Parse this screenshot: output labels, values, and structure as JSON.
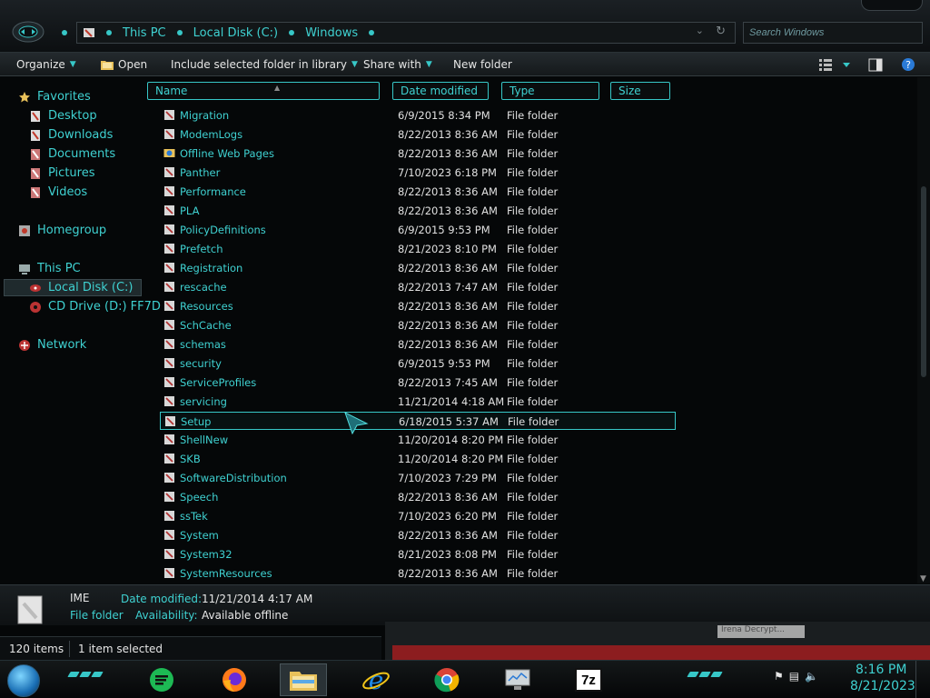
{
  "address_bar": {
    "crumbs": [
      "This PC",
      "Local Disk (C:)",
      "Windows"
    ],
    "search_placeholder": "Search Windows"
  },
  "toolbar": {
    "organize": "Organize",
    "open": "Open",
    "include": "Include selected folder in library",
    "share": "Share with",
    "new_folder": "New folder"
  },
  "nav": {
    "favorites": "Favorites",
    "desktop": "Desktop",
    "downloads": "Downloads",
    "documents": "Documents",
    "pictures": "Pictures",
    "videos": "Videos",
    "homegroup": "Homegroup",
    "this_pc": "This PC",
    "local_disk": "Local Disk (C:)",
    "cd_drive": "CD Drive (D:) FF7D",
    "network": "Network"
  },
  "columns": {
    "name": "Name",
    "date": "Date modified",
    "type": "Type",
    "size": "Size"
  },
  "files": [
    {
      "name": "Migration",
      "date": "6/9/2015 8:34 PM",
      "type": "File folder"
    },
    {
      "name": "ModemLogs",
      "date": "8/22/2013 8:36 AM",
      "type": "File folder"
    },
    {
      "name": "Offline Web Pages",
      "date": "8/22/2013 8:36 AM",
      "type": "File folder"
    },
    {
      "name": "Panther",
      "date": "7/10/2023 6:18 PM",
      "type": "File folder"
    },
    {
      "name": "Performance",
      "date": "8/22/2013 8:36 AM",
      "type": "File folder"
    },
    {
      "name": "PLA",
      "date": "8/22/2013 8:36 AM",
      "type": "File folder"
    },
    {
      "name": "PolicyDefinitions",
      "date": "6/9/2015 9:53 PM",
      "type": "File folder"
    },
    {
      "name": "Prefetch",
      "date": "8/21/2023 8:10 PM",
      "type": "File folder"
    },
    {
      "name": "Registration",
      "date": "8/22/2013 8:36 AM",
      "type": "File folder"
    },
    {
      "name": "rescache",
      "date": "8/22/2013 7:47 AM",
      "type": "File folder"
    },
    {
      "name": "Resources",
      "date": "8/22/2013 8:36 AM",
      "type": "File folder"
    },
    {
      "name": "SchCache",
      "date": "8/22/2013 8:36 AM",
      "type": "File folder"
    },
    {
      "name": "schemas",
      "date": "8/22/2013 8:36 AM",
      "type": "File folder"
    },
    {
      "name": "security",
      "date": "6/9/2015 9:53 PM",
      "type": "File folder"
    },
    {
      "name": "ServiceProfiles",
      "date": "8/22/2013 7:45 AM",
      "type": "File folder"
    },
    {
      "name": "servicing",
      "date": "11/21/2014 4:18 AM",
      "type": "File folder"
    },
    {
      "name": "Setup",
      "date": "6/18/2015 5:37 AM",
      "type": "File folder"
    },
    {
      "name": "ShellNew",
      "date": "11/20/2014 8:20 PM",
      "type": "File folder"
    },
    {
      "name": "SKB",
      "date": "11/20/2014 8:20 PM",
      "type": "File folder"
    },
    {
      "name": "SoftwareDistribution",
      "date": "7/10/2023 7:29 PM",
      "type": "File folder"
    },
    {
      "name": "Speech",
      "date": "8/22/2013 8:36 AM",
      "type": "File folder"
    },
    {
      "name": "ssTek",
      "date": "7/10/2023 6:20 PM",
      "type": "File folder"
    },
    {
      "name": "System",
      "date": "8/22/2013 8:36 AM",
      "type": "File folder"
    },
    {
      "name": "System32",
      "date": "8/21/2023 8:08 PM",
      "type": "File folder"
    },
    {
      "name": "SystemResources",
      "date": "8/22/2013 8:36 AM",
      "type": "File folder"
    }
  ],
  "selected_row": "Setup",
  "details": {
    "name": "IME",
    "type": "File folder",
    "date_label": "Date modified:",
    "date_value": "11/21/2014 4:17 AM",
    "avail_label": "Availability:",
    "avail_value": "Available offline"
  },
  "status": {
    "items": "120 items",
    "selected": "1 item selected"
  },
  "background_window": {
    "tooltip": "Irena Decrypt..."
  },
  "taskbar": {
    "apps": [
      "sheets-icon",
      "firefox-icon",
      "file-explorer-icon",
      "ie-icon",
      "chrome-icon",
      "monitor-icon",
      "7zip-icon"
    ],
    "zip_label": "7z",
    "time": "8:16 PM",
    "date": "8/21/2023"
  },
  "colors": {
    "accent": "#3fd1d1",
    "background": "#050708",
    "text": "#e0e0e0"
  }
}
